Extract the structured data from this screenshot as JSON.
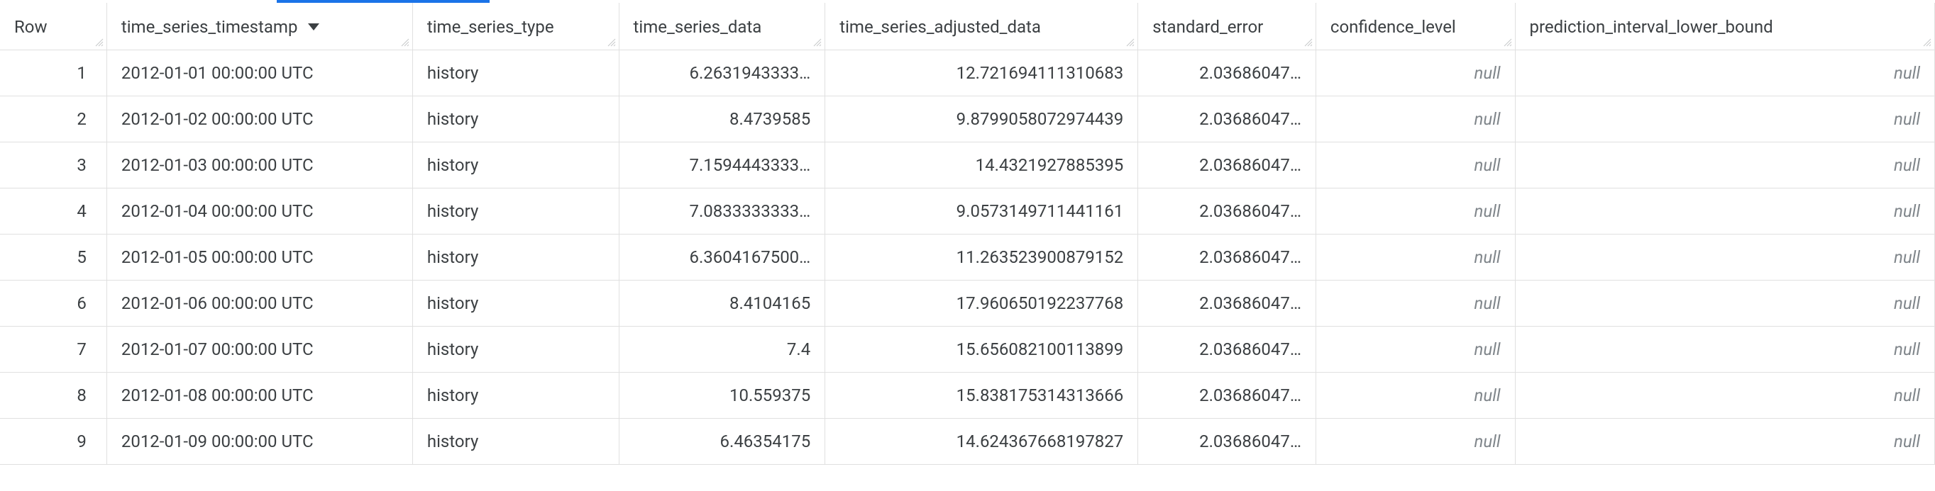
{
  "columns": {
    "row": "Row",
    "timestamp": "time_series_timestamp",
    "type": "time_series_type",
    "data": "time_series_data",
    "adjusted": "time_series_adjusted_data",
    "standard_error": "standard_error",
    "confidence_level": "confidence_level",
    "pilb": "prediction_interval_lower_bound"
  },
  "null_label": "null",
  "sorted_column": "time_series_timestamp",
  "sort_direction": "desc",
  "rows": [
    {
      "n": "1",
      "timestamp": "2012-01-01 00:00:00 UTC",
      "type": "history",
      "data": "6.2631943333…",
      "adjusted": "12.721694111310683",
      "se": "2.03686047…",
      "cl": null,
      "pilb": null
    },
    {
      "n": "2",
      "timestamp": "2012-01-02 00:00:00 UTC",
      "type": "history",
      "data": "8.4739585",
      "adjusted": "9.8799058072974439",
      "se": "2.03686047…",
      "cl": null,
      "pilb": null
    },
    {
      "n": "3",
      "timestamp": "2012-01-03 00:00:00 UTC",
      "type": "history",
      "data": "7.1594443333…",
      "adjusted": "14.4321927885395",
      "se": "2.03686047…",
      "cl": null,
      "pilb": null
    },
    {
      "n": "4",
      "timestamp": "2012-01-04 00:00:00 UTC",
      "type": "history",
      "data": "7.0833333333…",
      "adjusted": "9.0573149711441161",
      "se": "2.03686047…",
      "cl": null,
      "pilb": null
    },
    {
      "n": "5",
      "timestamp": "2012-01-05 00:00:00 UTC",
      "type": "history",
      "data": "6.3604167500…",
      "adjusted": "11.263523900879152",
      "se": "2.03686047…",
      "cl": null,
      "pilb": null
    },
    {
      "n": "6",
      "timestamp": "2012-01-06 00:00:00 UTC",
      "type": "history",
      "data": "8.4104165",
      "adjusted": "17.960650192237768",
      "se": "2.03686047…",
      "cl": null,
      "pilb": null
    },
    {
      "n": "7",
      "timestamp": "2012-01-07 00:00:00 UTC",
      "type": "history",
      "data": "7.4",
      "adjusted": "15.656082100113899",
      "se": "2.03686047…",
      "cl": null,
      "pilb": null
    },
    {
      "n": "8",
      "timestamp": "2012-01-08 00:00:00 UTC",
      "type": "history",
      "data": "10.559375",
      "adjusted": "15.838175314313666",
      "se": "2.03686047…",
      "cl": null,
      "pilb": null
    },
    {
      "n": "9",
      "timestamp": "2012-01-09 00:00:00 UTC",
      "type": "history",
      "data": "6.46354175",
      "adjusted": "14.624367668197827",
      "se": "2.03686047…",
      "cl": null,
      "pilb": null
    }
  ]
}
